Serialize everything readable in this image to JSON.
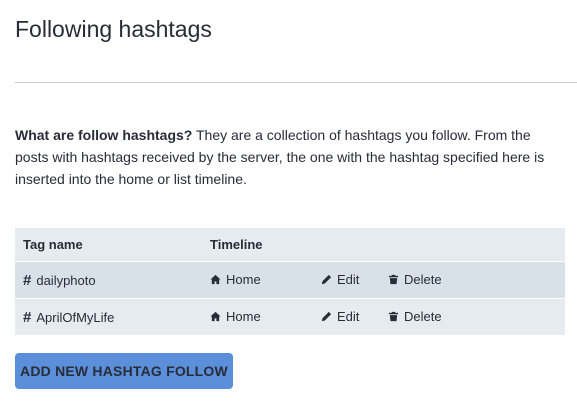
{
  "page": {
    "title": "Following hashtags"
  },
  "intro": {
    "lead": "What are follow hashtags?",
    "text": " They are a collection of hashtags you follow. From the posts with hashtags received by the server, the one with the hashtag specified here is inserted into the home or list timeline."
  },
  "table": {
    "headers": {
      "tag": "Tag name",
      "timeline": "Timeline"
    },
    "rows": [
      {
        "tag": "dailyphoto",
        "timeline": "Home",
        "edit": "Edit",
        "delete": "Delete"
      },
      {
        "tag": "AprilOfMyLife",
        "timeline": "Home",
        "edit": "Edit",
        "delete": "Delete"
      }
    ]
  },
  "actions": {
    "add_label": "Add new hashtag follow"
  },
  "icons": {
    "hashtag": "hashtag-icon",
    "home": "home-icon",
    "edit": "pencil-icon",
    "delete": "trash-icon"
  },
  "colors": {
    "accent": "#5b8fd9",
    "row_background": "#d9e1e8",
    "header_background": "#e6ebf0",
    "text": "#282c37"
  }
}
